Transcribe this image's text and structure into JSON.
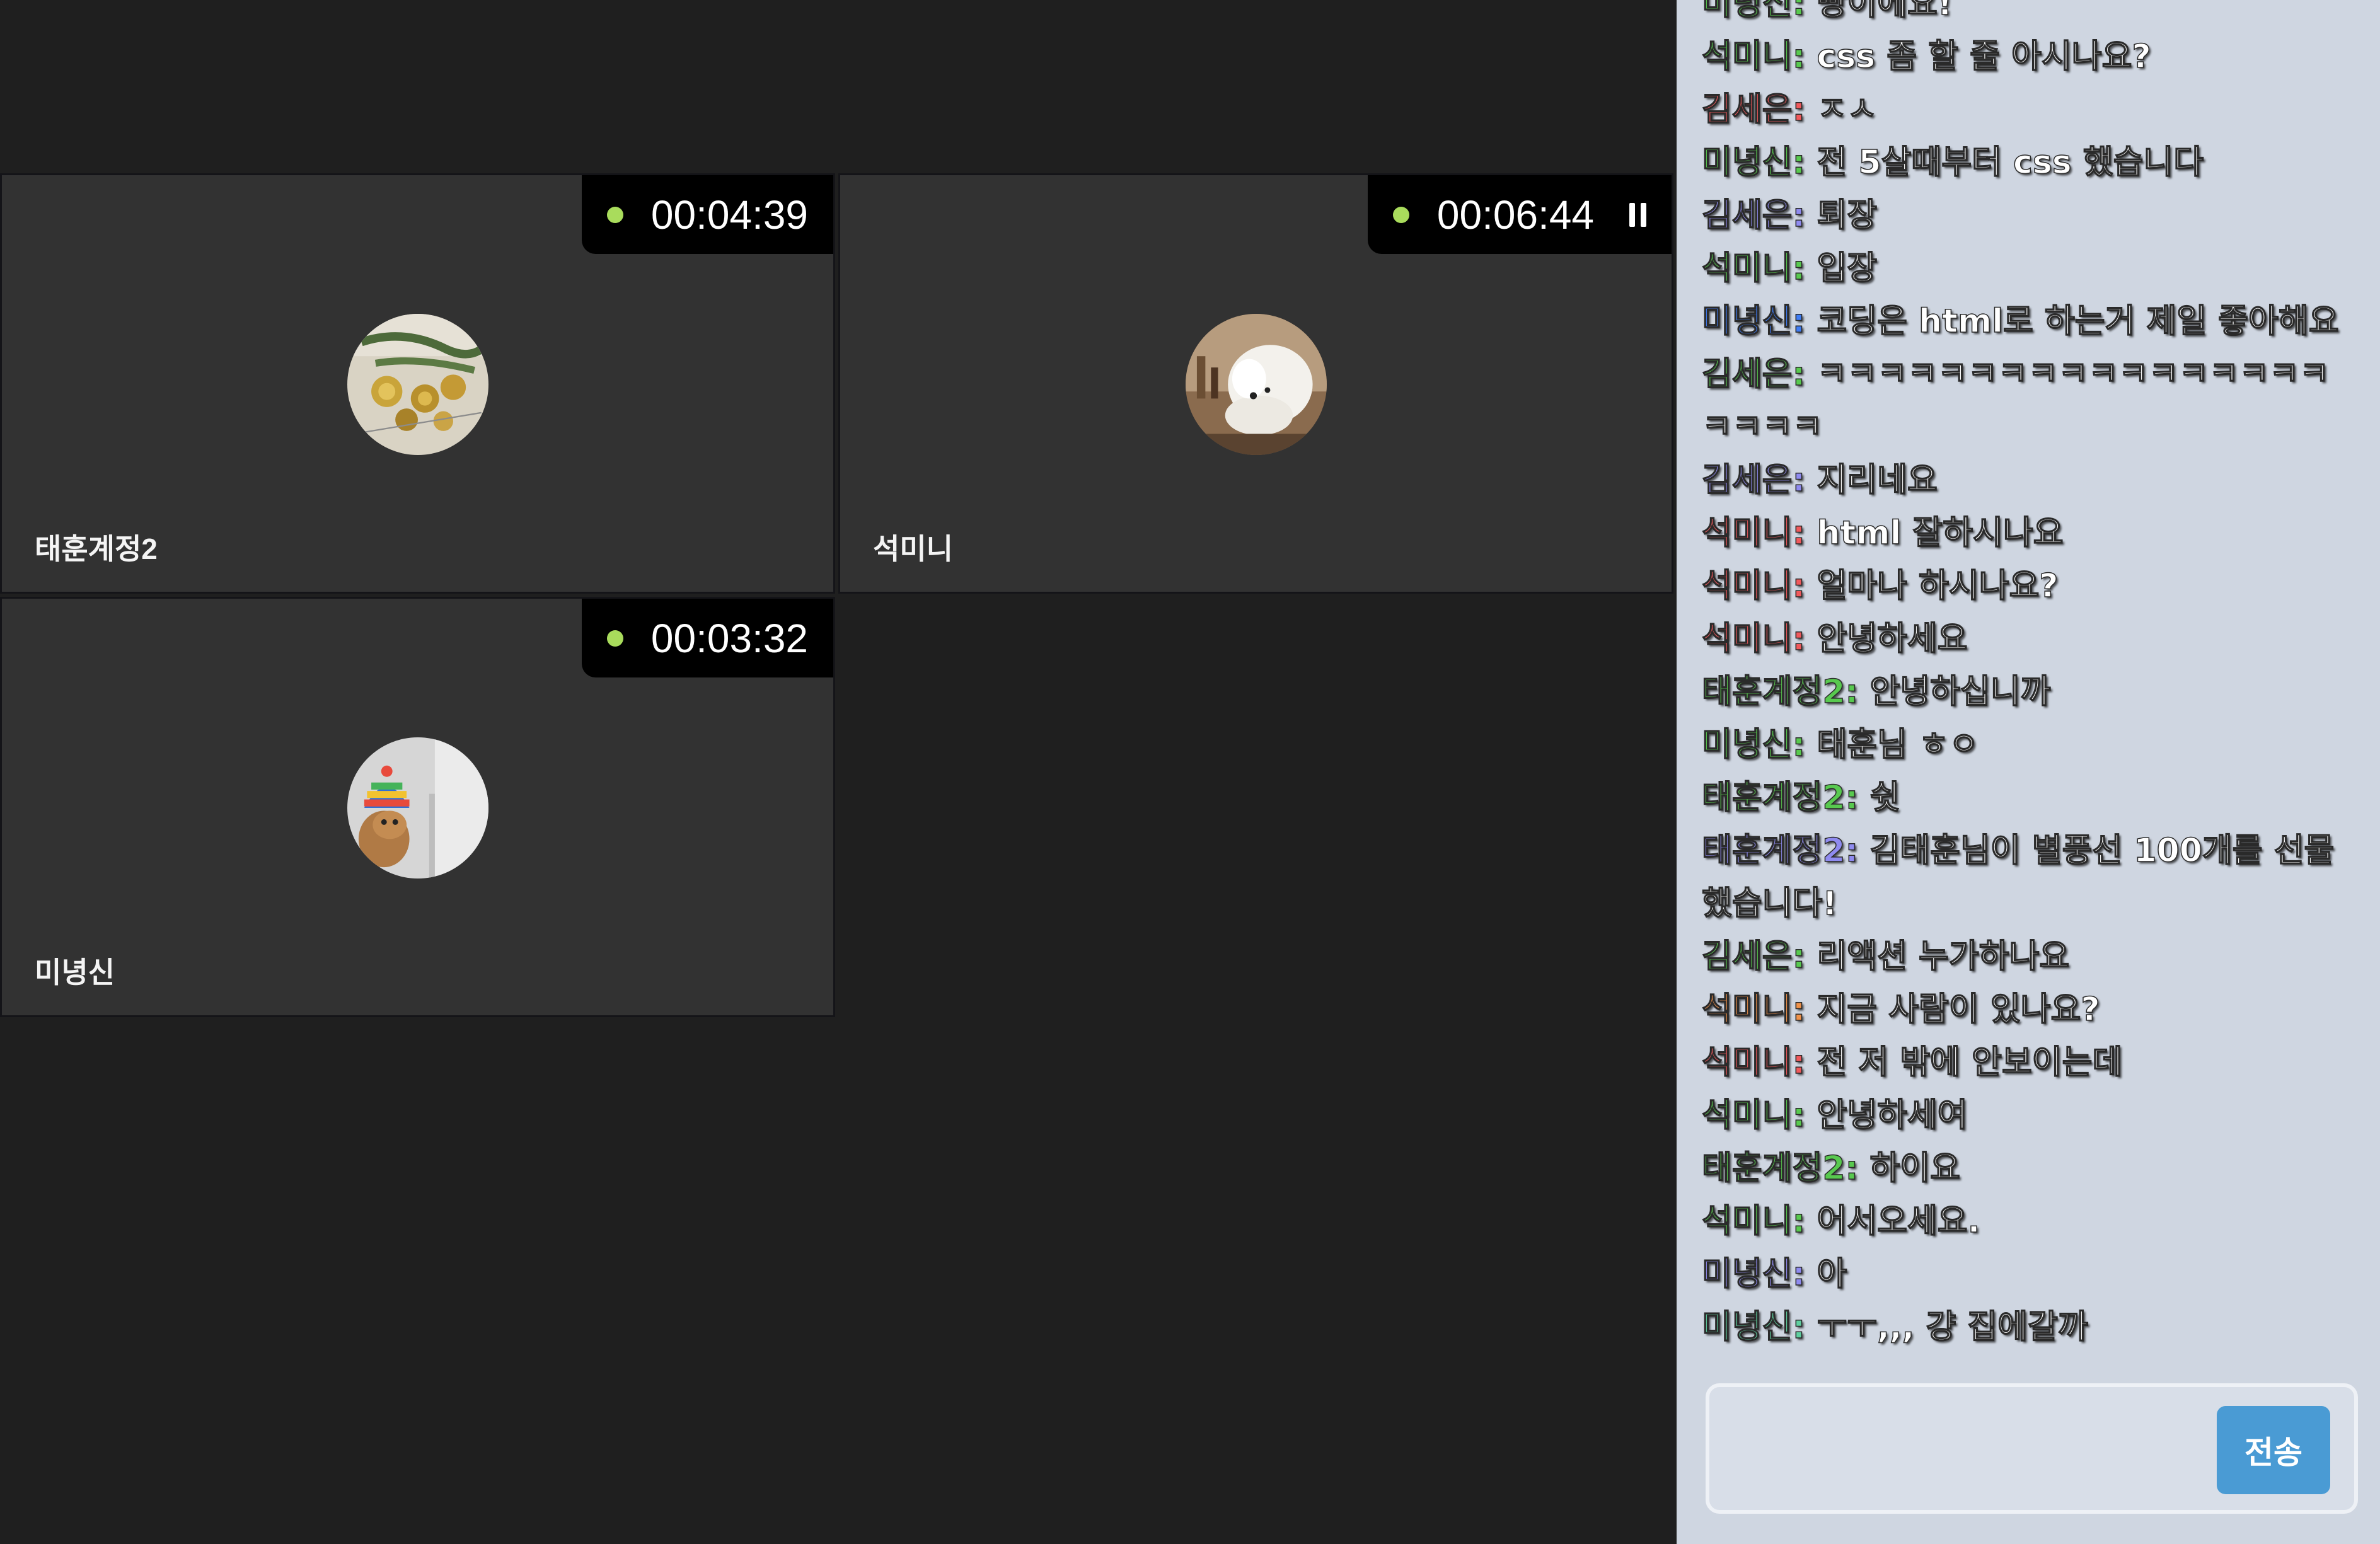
{
  "colors": {
    "stage_bg": "#1f1f1f",
    "tile_bg": "#323232",
    "chat_bg": "#cfd6e1",
    "live_dot": "#a9dc5c",
    "send_button": "#4a9bd4"
  },
  "tiles": [
    {
      "name": "태훈계정2",
      "timer": "00:04:39",
      "paused": false,
      "avatar": "gold-ornaments-photo"
    },
    {
      "name": "석미니",
      "timer": "00:06:44",
      "paused": true,
      "avatar": "white-dog-photo"
    },
    {
      "name": "미녕신",
      "timer": "00:03:32",
      "paused": false,
      "avatar": "dog-in-rainbow-hat-photo"
    }
  ],
  "chat": {
    "messages": [
      {
        "sender": "미녕신",
        "color": "#58c94f",
        "text": "빵이에요!"
      },
      {
        "sender": "석미니",
        "color": "#58c94f",
        "text": "css 좀 할 줄 아시나요?"
      },
      {
        "sender": "김세은",
        "color": "#f0595c",
        "text": "ㅈㅅ"
      },
      {
        "sender": "미녕신",
        "color": "#58c94f",
        "text": "전 5살때부터 css 했습니다"
      },
      {
        "sender": "김세은",
        "color": "#8f8bf0",
        "text": "퇴장"
      },
      {
        "sender": "석미니",
        "color": "#58c94f",
        "text": "입장"
      },
      {
        "sender": "미녕신",
        "color": "#3f7df5",
        "text": "코딩은 html로 하는거 제일 좋아해요"
      },
      {
        "sender": "김세은",
        "color": "#58c94f",
        "text": "ㅋㅋㅋㅋㅋㅋㅋㅋㅋㅋㅋㅋㅋㅋㅋㅋㅋㅋㅋㅋㅋ"
      },
      {
        "sender": "김세은",
        "color": "#8f8bf0",
        "text": "지리네요"
      },
      {
        "sender": "석미니",
        "color": "#f0595c",
        "text": "html 잘하시나요"
      },
      {
        "sender": "석미니",
        "color": "#f0595c",
        "text": "얼마나 하시나요?"
      },
      {
        "sender": "석미니",
        "color": "#f0595c",
        "text": "안녕하세요"
      },
      {
        "sender": "태훈계정2",
        "color": "#58c94f",
        "text": "안녕하십니까"
      },
      {
        "sender": "미녕신",
        "color": "#58c94f",
        "text": "태훈님 ㅎㅇ"
      },
      {
        "sender": "태훈계정2",
        "color": "#58c94f",
        "text": "쉿"
      },
      {
        "sender": "태훈계정2",
        "color": "#8f8bf0",
        "text": "김태훈님이 별풍선 100개를 선물했습니다!"
      },
      {
        "sender": "김세은",
        "color": "#58c94f",
        "text": "리액션 누가하나요"
      },
      {
        "sender": "석미니",
        "color": "#f0924a",
        "text": "지금 사람이 있나요?"
      },
      {
        "sender": "석미니",
        "color": "#f0595c",
        "text": "전 저 밖에 안보이는데"
      },
      {
        "sender": "석미니",
        "color": "#58c94f",
        "text": "안녕하세여"
      },
      {
        "sender": "태훈계정2",
        "color": "#58c94f",
        "text": "하이요"
      },
      {
        "sender": "석미니",
        "color": "#58c94f",
        "text": "어서오세요."
      },
      {
        "sender": "미녕신",
        "color": "#8f8bf0",
        "text": "아"
      },
      {
        "sender": "미녕신",
        "color": "#5fcfa0",
        "text": "ㅜㅜ,,, 걍 집에갈까"
      }
    ],
    "separator": ": ",
    "input_value": "",
    "send_label": "전송"
  }
}
